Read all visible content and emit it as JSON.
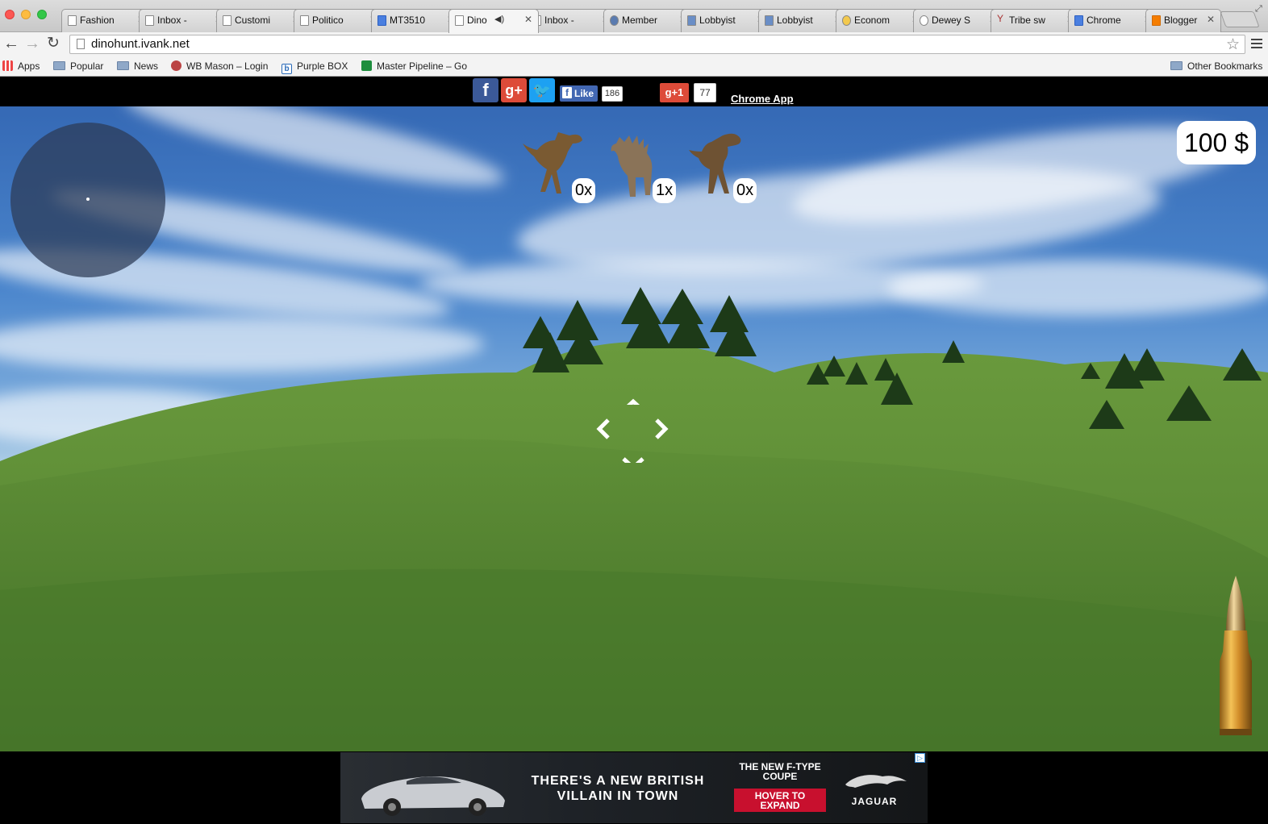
{
  "browser": {
    "tabs": [
      {
        "label": "Fashion",
        "active": false
      },
      {
        "label": "Inbox -",
        "active": false
      },
      {
        "label": "Customi",
        "active": false
      },
      {
        "label": "Politico",
        "active": false
      },
      {
        "label": "MT3510",
        "active": false
      },
      {
        "label": "Dino",
        "active": true
      },
      {
        "label": "Inbox -",
        "active": false
      },
      {
        "label": "Member",
        "active": false
      },
      {
        "label": "Lobbyist",
        "active": false
      },
      {
        "label": "Lobbyist",
        "active": false
      },
      {
        "label": "Econom",
        "active": false
      },
      {
        "label": "Dewey S",
        "active": false
      },
      {
        "label": "Tribe sw",
        "active": false
      },
      {
        "label": "Chrome",
        "active": false
      },
      {
        "label": "Blogger",
        "active": false
      }
    ],
    "url": "dinohunt.ivank.net",
    "bookmarks": {
      "apps": "Apps",
      "popular": "Popular",
      "news": "News",
      "wbmason": "WB Mason – Login",
      "purplebox": "Purple BOX",
      "pipeline": "Master Pipeline – Go",
      "other": "Other Bookmarks"
    }
  },
  "social": {
    "like_label": "Like",
    "like_count": "186",
    "plusone_label": "g+1",
    "plusone_count": "77",
    "chrome_app": "Chrome App"
  },
  "game": {
    "money": "100 $",
    "targets": [
      {
        "species": "velociraptor",
        "kills": "0x"
      },
      {
        "species": "stegosaurus",
        "kills": "1x"
      },
      {
        "species": "tyrannosaurus",
        "kills": "0x"
      }
    ],
    "controls": {
      "up": "⌃",
      "down": "⌄",
      "left": "‹",
      "right": "›"
    }
  },
  "ad": {
    "headline": "THERE'S A NEW BRITISH VILLAIN IN TOWN",
    "tagline": "THE NEW F-TYPE COUPE",
    "cta": "HOVER TO EXPAND",
    "brand": "JAGUAR"
  },
  "colors": {
    "sky": "#4a85cc",
    "grass": "#5e8c34",
    "ad_red": "#c8102e",
    "facebook": "#3b5998",
    "googleplus": "#dd4b39",
    "twitter": "#1da1f2"
  }
}
